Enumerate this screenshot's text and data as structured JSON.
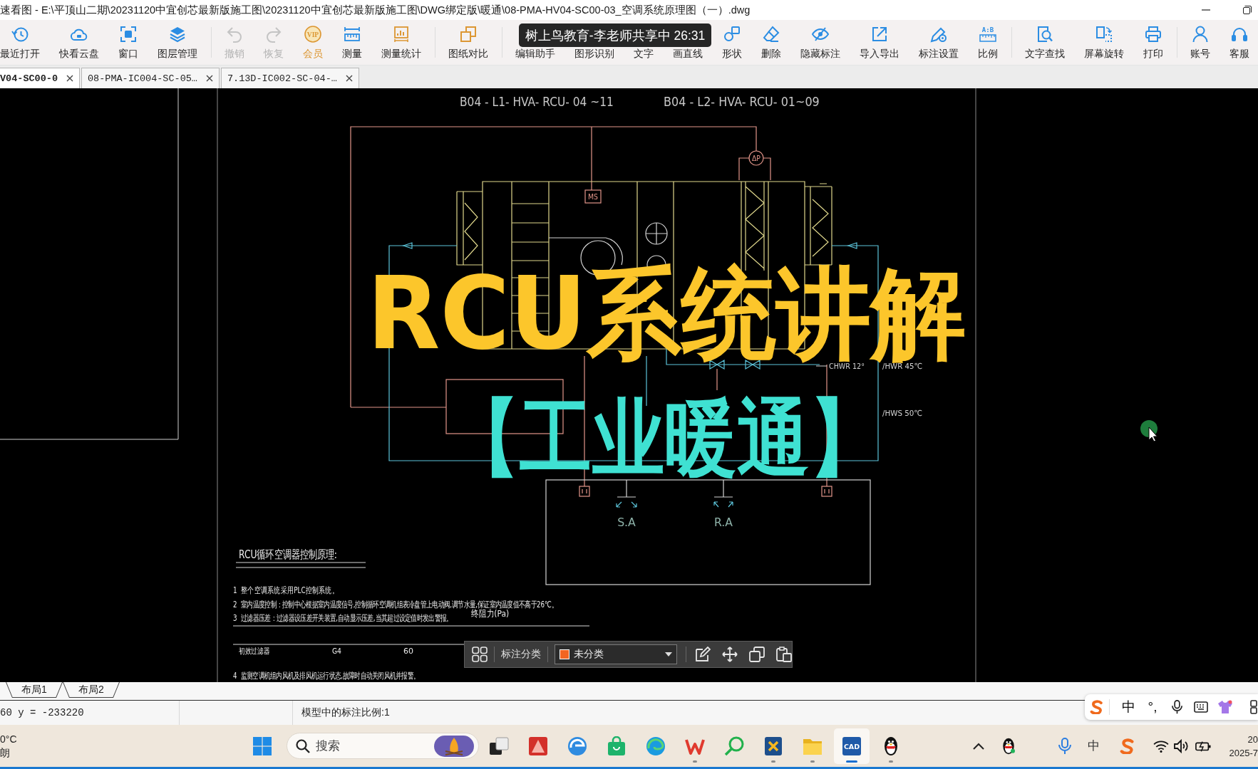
{
  "window": {
    "title": "速看图 - E:\\平顶山二期\\20231120中宜创芯最新版施工图\\20231120中宜创芯最新版施工图\\DWG绑定版\\暖通\\08-PMA-HV04-SC00-03_空调系统原理图（一）.dwg"
  },
  "toolbar": {
    "groups": [
      [
        {
          "label": "最近打开",
          "kind": "tool",
          "disabled": false,
          "covered": false
        },
        {
          "label": "快看云盘",
          "kind": "tool",
          "disabled": false,
          "covered": false
        },
        {
          "label": "窗口",
          "kind": "tool",
          "disabled": false,
          "covered": false
        },
        {
          "label": "图层管理",
          "kind": "tool",
          "disabled": false,
          "covered": false
        }
      ],
      [
        {
          "label": "撤销",
          "kind": "tool",
          "disabled": true,
          "covered": false
        },
        {
          "label": "恢复",
          "kind": "tool",
          "disabled": true,
          "covered": false
        },
        {
          "label": "会员",
          "kind": "vip",
          "disabled": false,
          "covered": false,
          "badge": "VIP"
        },
        {
          "label": "测量",
          "kind": "tool",
          "disabled": false,
          "covered": false
        },
        {
          "label": "测量统计",
          "kind": "tool",
          "disabled": false,
          "covered": false
        }
      ],
      [
        {
          "label": "图纸对比",
          "kind": "tool",
          "disabled": false,
          "covered": false
        }
      ],
      [
        {
          "label": "编辑助手",
          "kind": "tool",
          "disabled": false,
          "covered": true
        },
        {
          "label": "图形识别",
          "kind": "tool",
          "disabled": false,
          "covered": true
        },
        {
          "label": "文字",
          "kind": "tool",
          "disabled": false,
          "covered": true
        },
        {
          "label": "画直线",
          "kind": "tool",
          "disabled": false,
          "covered": true
        },
        {
          "label": "形状",
          "kind": "tool",
          "disabled": false,
          "covered": false
        },
        {
          "label": "删除",
          "kind": "tool",
          "disabled": false,
          "covered": false
        },
        {
          "label": "隐藏标注",
          "kind": "tool",
          "disabled": false,
          "covered": false
        },
        {
          "label": "导入导出",
          "kind": "tool",
          "disabled": false,
          "covered": false
        },
        {
          "label": "标注设置",
          "kind": "tool",
          "disabled": false,
          "covered": false
        },
        {
          "label": "比例",
          "kind": "tool",
          "disabled": false,
          "covered": false,
          "badge": "A:B"
        }
      ],
      [
        {
          "label": "文字查找",
          "kind": "tool",
          "disabled": false,
          "covered": false
        },
        {
          "label": "屏幕旋转",
          "kind": "tool",
          "disabled": false,
          "covered": false
        },
        {
          "label": "打印",
          "kind": "tool",
          "disabled": false,
          "covered": false
        }
      ],
      [
        {
          "label": "账号",
          "kind": "tool",
          "disabled": false,
          "covered": false
        },
        {
          "label": "客服",
          "kind": "tool",
          "disabled": false,
          "covered": false
        }
      ]
    ]
  },
  "screen_share_banner": {
    "text": "树上鸟教育-李老师共享中 26:31"
  },
  "file_tabs": [
    {
      "label": "V04-SC00-0",
      "selected": true
    },
    {
      "label": "08-PMA-IC004-SC-05…",
      "selected": false
    },
    {
      "label": "7.13D-IC002-SC-04-…",
      "selected": false
    }
  ],
  "drawing": {
    "sheet_titles": [
      "B04 - L1- HVA- RCU- 04 ~11",
      "B04 - L2- HVA- RCU- 01~09"
    ],
    "schematic": {
      "motor_label": "MS",
      "pressure_label": "ΔP",
      "chilled_return_label": "CHWR 12°",
      "hot_return_label": "/HWR 45℃",
      "hot_supply_label": "/HWS 50℃",
      "supply_air_label": "S.A",
      "return_air_label": "R.A"
    },
    "notes": {
      "heading": "RCU循环空调器控制原理:",
      "items": [
        "1  整个空调系统采用PLC控制系统。",
        "2  室内温度控制：控制中心根据室内温度信号,控制循环空调机组表冷盘管上电动阀,调节水量,保证室内温度值不高于26℃。",
        "3  过滤器压差：过滤器设压差开关装置,自动显示压差,当其超过设定值时发出警报。",
        "4  监测空调机组内风机及排风机运行状态,故障时自动关闭风机并报警。"
      ],
      "resistance_label": "终阻力(Pa)",
      "filter_row": [
        "初效过滤器",
        "G4",
        "60"
      ]
    }
  },
  "overlay_title": {
    "headline": "RCU系统讲解",
    "subline": "【工业暖通】"
  },
  "annotation_toolbar": {
    "label": "标注分类",
    "category": "未分类"
  },
  "layout_tabs": [
    {
      "label": "布局1",
      "selected": false
    },
    {
      "label": "布局2",
      "selected": false
    }
  ],
  "status_bar": {
    "coordinates": "60 y = -233220",
    "annotation_scale": "模型中的标注比例:1"
  },
  "input_method_bar": {
    "mode": "中",
    "punctuation": "°,"
  },
  "taskbar": {
    "weather": {
      "temperature": "0°C",
      "condition": "朗"
    },
    "search": {
      "placeholder": "搜索"
    },
    "apps": [
      {
        "running": false,
        "selected": false
      },
      {
        "running": false,
        "selected": false
      },
      {
        "running": false,
        "selected": false
      },
      {
        "running": false,
        "selected": false
      },
      {
        "running": false,
        "selected": false
      },
      {
        "running": true,
        "selected": false
      },
      {
        "running": false,
        "selected": false
      },
      {
        "running": true,
        "selected": false
      },
      {
        "running": true,
        "selected": false
      },
      {
        "running": true,
        "selected": true,
        "badge": "CAD"
      },
      {
        "running": true,
        "selected": false
      }
    ],
    "tray": {
      "input_mode": "中"
    },
    "clock": {
      "time": "20",
      "date": "2025-7"
    }
  }
}
